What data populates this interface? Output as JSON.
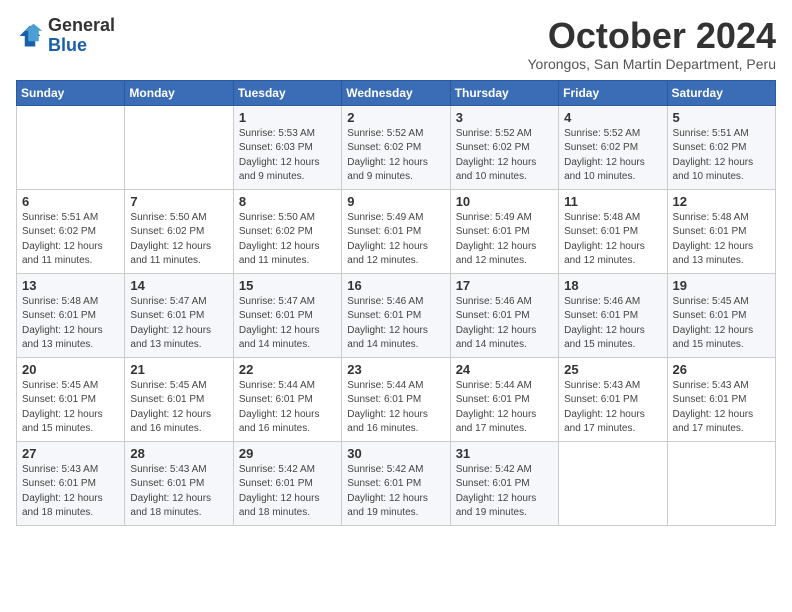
{
  "header": {
    "logo_general": "General",
    "logo_blue": "Blue",
    "month_year": "October 2024",
    "location": "Yorongos, San Martin Department, Peru"
  },
  "days_of_week": [
    "Sunday",
    "Monday",
    "Tuesday",
    "Wednesday",
    "Thursday",
    "Friday",
    "Saturday"
  ],
  "weeks": [
    [
      {
        "day": "",
        "detail": ""
      },
      {
        "day": "",
        "detail": ""
      },
      {
        "day": "1",
        "detail": "Sunrise: 5:53 AM\nSunset: 6:03 PM\nDaylight: 12 hours\nand 9 minutes."
      },
      {
        "day": "2",
        "detail": "Sunrise: 5:52 AM\nSunset: 6:02 PM\nDaylight: 12 hours\nand 9 minutes."
      },
      {
        "day": "3",
        "detail": "Sunrise: 5:52 AM\nSunset: 6:02 PM\nDaylight: 12 hours\nand 10 minutes."
      },
      {
        "day": "4",
        "detail": "Sunrise: 5:52 AM\nSunset: 6:02 PM\nDaylight: 12 hours\nand 10 minutes."
      },
      {
        "day": "5",
        "detail": "Sunrise: 5:51 AM\nSunset: 6:02 PM\nDaylight: 12 hours\nand 10 minutes."
      }
    ],
    [
      {
        "day": "6",
        "detail": "Sunrise: 5:51 AM\nSunset: 6:02 PM\nDaylight: 12 hours\nand 11 minutes."
      },
      {
        "day": "7",
        "detail": "Sunrise: 5:50 AM\nSunset: 6:02 PM\nDaylight: 12 hours\nand 11 minutes."
      },
      {
        "day": "8",
        "detail": "Sunrise: 5:50 AM\nSunset: 6:02 PM\nDaylight: 12 hours\nand 11 minutes."
      },
      {
        "day": "9",
        "detail": "Sunrise: 5:49 AM\nSunset: 6:01 PM\nDaylight: 12 hours\nand 12 minutes."
      },
      {
        "day": "10",
        "detail": "Sunrise: 5:49 AM\nSunset: 6:01 PM\nDaylight: 12 hours\nand 12 minutes."
      },
      {
        "day": "11",
        "detail": "Sunrise: 5:48 AM\nSunset: 6:01 PM\nDaylight: 12 hours\nand 12 minutes."
      },
      {
        "day": "12",
        "detail": "Sunrise: 5:48 AM\nSunset: 6:01 PM\nDaylight: 12 hours\nand 13 minutes."
      }
    ],
    [
      {
        "day": "13",
        "detail": "Sunrise: 5:48 AM\nSunset: 6:01 PM\nDaylight: 12 hours\nand 13 minutes."
      },
      {
        "day": "14",
        "detail": "Sunrise: 5:47 AM\nSunset: 6:01 PM\nDaylight: 12 hours\nand 13 minutes."
      },
      {
        "day": "15",
        "detail": "Sunrise: 5:47 AM\nSunset: 6:01 PM\nDaylight: 12 hours\nand 14 minutes."
      },
      {
        "day": "16",
        "detail": "Sunrise: 5:46 AM\nSunset: 6:01 PM\nDaylight: 12 hours\nand 14 minutes."
      },
      {
        "day": "17",
        "detail": "Sunrise: 5:46 AM\nSunset: 6:01 PM\nDaylight: 12 hours\nand 14 minutes."
      },
      {
        "day": "18",
        "detail": "Sunrise: 5:46 AM\nSunset: 6:01 PM\nDaylight: 12 hours\nand 15 minutes."
      },
      {
        "day": "19",
        "detail": "Sunrise: 5:45 AM\nSunset: 6:01 PM\nDaylight: 12 hours\nand 15 minutes."
      }
    ],
    [
      {
        "day": "20",
        "detail": "Sunrise: 5:45 AM\nSunset: 6:01 PM\nDaylight: 12 hours\nand 15 minutes."
      },
      {
        "day": "21",
        "detail": "Sunrise: 5:45 AM\nSunset: 6:01 PM\nDaylight: 12 hours\nand 16 minutes."
      },
      {
        "day": "22",
        "detail": "Sunrise: 5:44 AM\nSunset: 6:01 PM\nDaylight: 12 hours\nand 16 minutes."
      },
      {
        "day": "23",
        "detail": "Sunrise: 5:44 AM\nSunset: 6:01 PM\nDaylight: 12 hours\nand 16 minutes."
      },
      {
        "day": "24",
        "detail": "Sunrise: 5:44 AM\nSunset: 6:01 PM\nDaylight: 12 hours\nand 17 minutes."
      },
      {
        "day": "25",
        "detail": "Sunrise: 5:43 AM\nSunset: 6:01 PM\nDaylight: 12 hours\nand 17 minutes."
      },
      {
        "day": "26",
        "detail": "Sunrise: 5:43 AM\nSunset: 6:01 PM\nDaylight: 12 hours\nand 17 minutes."
      }
    ],
    [
      {
        "day": "27",
        "detail": "Sunrise: 5:43 AM\nSunset: 6:01 PM\nDaylight: 12 hours\nand 18 minutes."
      },
      {
        "day": "28",
        "detail": "Sunrise: 5:43 AM\nSunset: 6:01 PM\nDaylight: 12 hours\nand 18 minutes."
      },
      {
        "day": "29",
        "detail": "Sunrise: 5:42 AM\nSunset: 6:01 PM\nDaylight: 12 hours\nand 18 minutes."
      },
      {
        "day": "30",
        "detail": "Sunrise: 5:42 AM\nSunset: 6:01 PM\nDaylight: 12 hours\nand 19 minutes."
      },
      {
        "day": "31",
        "detail": "Sunrise: 5:42 AM\nSunset: 6:01 PM\nDaylight: 12 hours\nand 19 minutes."
      },
      {
        "day": "",
        "detail": ""
      },
      {
        "day": "",
        "detail": ""
      }
    ]
  ]
}
